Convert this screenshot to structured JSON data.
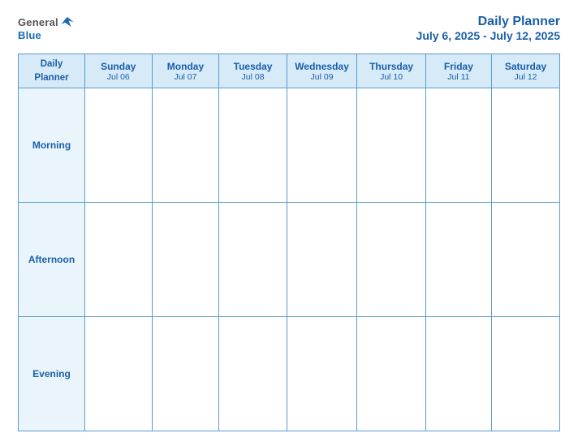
{
  "header": {
    "logo_general": "General",
    "logo_blue": "Blue",
    "title": "Daily Planner",
    "subtitle": "July 6, 2025 - July 12, 2025"
  },
  "table": {
    "corner_label_line1": "Daily",
    "corner_label_line2": "Planner",
    "columns": [
      {
        "day": "Sunday",
        "date": "Jul 06"
      },
      {
        "day": "Monday",
        "date": "Jul 07"
      },
      {
        "day": "Tuesday",
        "date": "Jul 08"
      },
      {
        "day": "Wednesday",
        "date": "Jul 09"
      },
      {
        "day": "Thursday",
        "date": "Jul 10"
      },
      {
        "day": "Friday",
        "date": "Jul 11"
      },
      {
        "day": "Saturday",
        "date": "Jul 12"
      }
    ],
    "rows": [
      {
        "label": "Morning"
      },
      {
        "label": "Afternoon"
      },
      {
        "label": "Evening"
      }
    ]
  }
}
